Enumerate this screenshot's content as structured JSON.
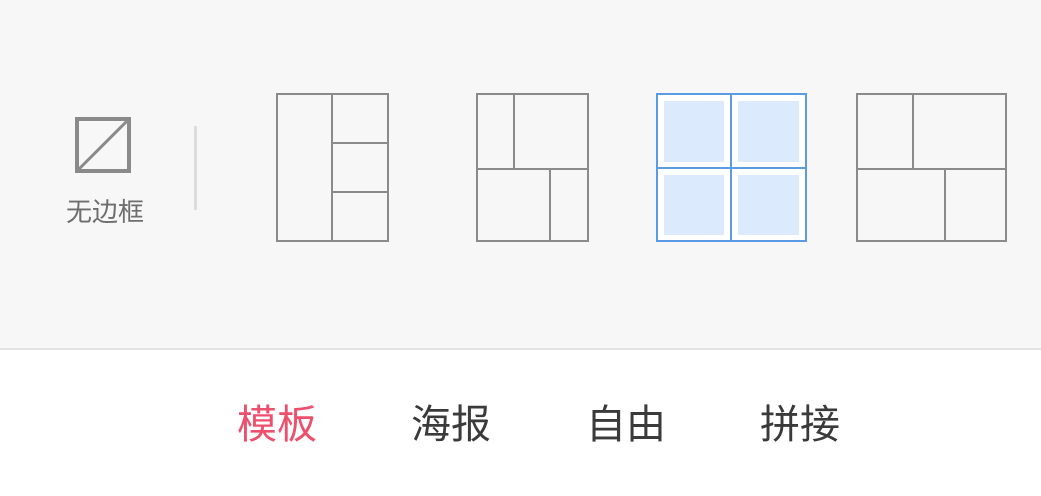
{
  "layout_picker": {
    "no_border_label": "无边框",
    "selected_index": 2,
    "colors": {
      "stroke": "#8a8a8a",
      "selected_stroke": "#5b9be6",
      "selected_fill": "#dbeafd",
      "accent": "#ee4f6c"
    },
    "templates": [
      {
        "name": "template-left-column-three-right"
      },
      {
        "name": "template-top-two-bottom-two"
      },
      {
        "name": "template-grid-2x2"
      },
      {
        "name": "template-wide-mixed"
      }
    ]
  },
  "tabs": {
    "items": [
      {
        "label": "模板",
        "active": true
      },
      {
        "label": "海报",
        "active": false
      },
      {
        "label": "自由",
        "active": false
      },
      {
        "label": "拼接",
        "active": false
      }
    ]
  }
}
